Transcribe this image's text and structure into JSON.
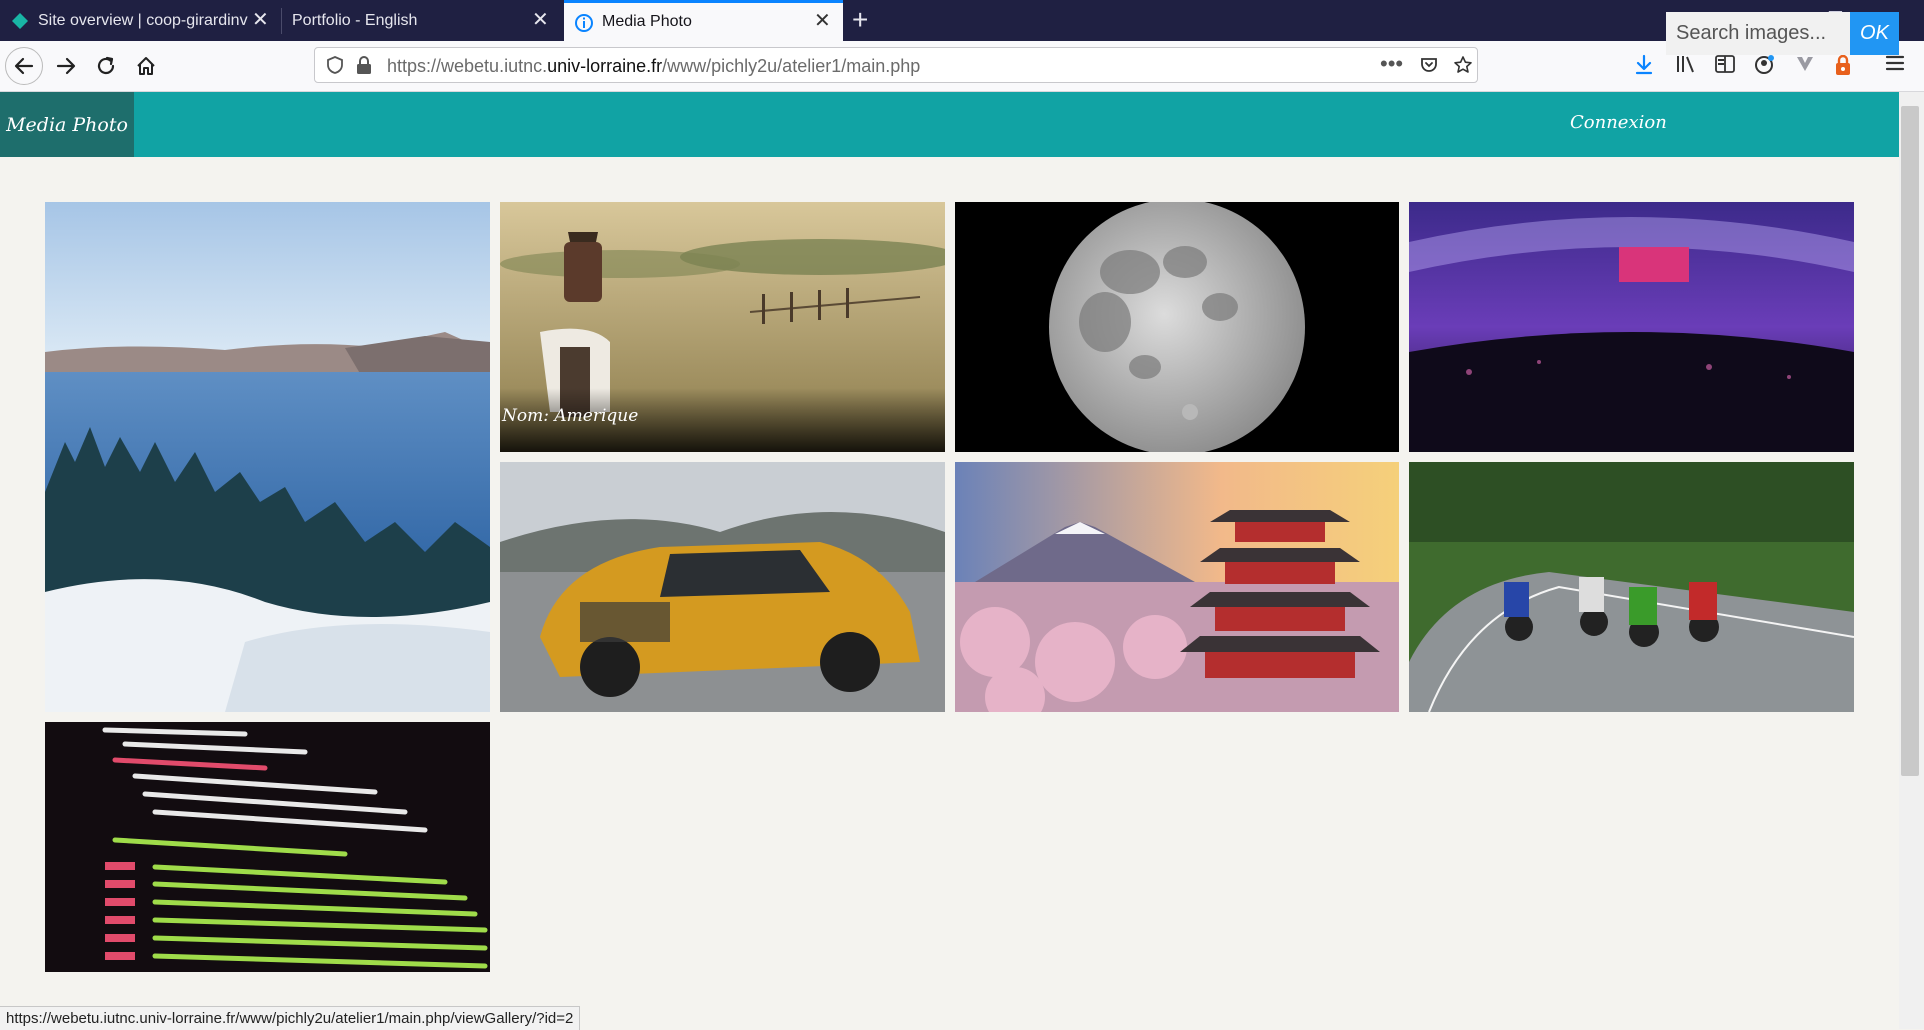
{
  "browser": {
    "tabs": [
      {
        "label": "Site overview | coop-girardinvi",
        "active": false
      },
      {
        "label": "Portfolio - English",
        "active": false
      },
      {
        "label": "Media Photo",
        "active": true
      }
    ],
    "url_prefix": "https://webetu.iutnc.",
    "url_domain": "univ-lorraine.fr",
    "url_path": "/www/pichly2u/atelier1/main.php",
    "status_url": "https://webetu.iutnc.univ-lorraine.fr/www/pichly2u/atelier1/main.php/viewGallery/?id=2"
  },
  "site": {
    "brand": "Media Photo",
    "connexion_label": "Connexion",
    "search_placeholder": "Search images...",
    "ok_label": "OK"
  },
  "gallery": {
    "hover_caption": "Nom: Amerique",
    "images": [
      {
        "name": "photo-lake"
      },
      {
        "name": "photo-cowboy"
      },
      {
        "name": "photo-moon"
      },
      {
        "name": "photo-arena"
      },
      {
        "name": "photo-yellow-car"
      },
      {
        "name": "photo-pagoda"
      },
      {
        "name": "photo-motorbikes"
      },
      {
        "name": "photo-code"
      }
    ]
  },
  "colors": {
    "navbar": "#11a3a4",
    "brand_bg": "#1e6e6c",
    "ok_button": "#2196f3",
    "tabstrip": "#1f2042"
  }
}
